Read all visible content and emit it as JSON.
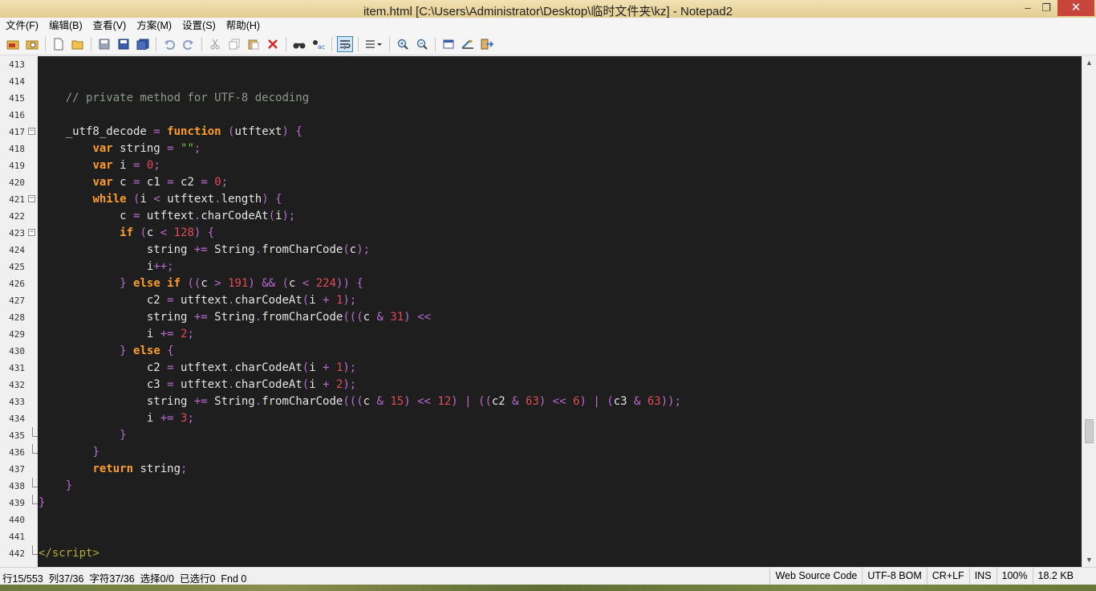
{
  "window": {
    "title": "item.html [C:\\Users\\Administrator\\Desktop\\临时文件夹\\kz] - Notepad2",
    "minimize_glyph": "–",
    "maximize_glyph": "❐",
    "close_glyph": "✕"
  },
  "menu": [
    "文件(F)",
    "编辑(B)",
    "查看(V)",
    "方案(M)",
    "设置(S)",
    "帮助(H)"
  ],
  "toolbar": {
    "icons": [
      "open-folder-icon",
      "browse-icon",
      "new-file-icon",
      "open-file-icon",
      "save-disabled-icon",
      "save-icon",
      "save-copy-icon",
      "undo-icon",
      "redo-icon",
      "cut-icon",
      "copy-icon",
      "paste-icon",
      "delete-icon",
      "find-icon",
      "replace-icon",
      "word-wrap-icon",
      "schemes-icon",
      "zoom-in-icon",
      "zoom-out-icon",
      "view-icon",
      "settings-icon",
      "exit-icon"
    ],
    "active_icon": "word-wrap-icon"
  },
  "editor": {
    "lines": [
      {
        "n": "413",
        "fold": "",
        "html": ""
      },
      {
        "n": "414",
        "fold": "",
        "html": ""
      },
      {
        "n": "415",
        "fold": "",
        "html": "    <span class='c'>// private method for UTF-8 decoding</span>"
      },
      {
        "n": "416",
        "fold": "",
        "html": ""
      },
      {
        "n": "417",
        "fold": "box",
        "html": "    _utf8_decode <span class='p'>=</span> <span class='k'>function</span> <span class='p'>(</span>utftext<span class='p'>)</span> <span class='p'>{</span>"
      },
      {
        "n": "418",
        "fold": "",
        "html": "        <span class='k'>var</span> string <span class='p'>=</span> <span class='s'>\"\"</span><span class='p'>;</span>"
      },
      {
        "n": "419",
        "fold": "",
        "html": "        <span class='k'>var</span> i <span class='p'>=</span> <span class='n'>0</span><span class='p'>;</span>"
      },
      {
        "n": "420",
        "fold": "",
        "html": "        <span class='k'>var</span> c <span class='p'>=</span> c1 <span class='p'>=</span> c2 <span class='p'>=</span> <span class='n'>0</span><span class='p'>;</span>"
      },
      {
        "n": "421",
        "fold": "box",
        "html": "        <span class='k'>while</span> <span class='p'>(</span>i <span class='p'>&lt;</span> utftext<span class='p'>.</span>length<span class='p'>)</span> <span class='p'>{</span>"
      },
      {
        "n": "422",
        "fold": "",
        "html": "            c <span class='p'>=</span> utftext<span class='p'>.</span>charCodeAt<span class='p'>(</span>i<span class='p'>);</span>"
      },
      {
        "n": "423",
        "fold": "box",
        "html": "            <span class='k'>if</span> <span class='p'>(</span>c <span class='p'>&lt;</span> <span class='n'>128</span><span class='p'>)</span> <span class='p'>{</span>"
      },
      {
        "n": "424",
        "fold": "",
        "html": "                string <span class='p'>+=</span> String<span class='p'>.</span>fromCharCode<span class='p'>(</span>c<span class='p'>);</span>"
      },
      {
        "n": "425",
        "fold": "",
        "html": "                i<span class='p'>++;</span>"
      },
      {
        "n": "426",
        "fold": "",
        "html": "            <span class='p'>}</span> <span class='k'>else if</span> <span class='p'>((</span>c <span class='p'>&gt;</span> <span class='n'>191</span><span class='p'>)</span> <span class='p'>&amp;&amp;</span> <span class='p'>(</span>c <span class='p'>&lt;</span> <span class='n'>224</span><span class='p'>))</span> <span class='p'>{</span>"
      },
      {
        "n": "427",
        "fold": "",
        "html": "                c2 <span class='p'>=</span> utftext<span class='p'>.</span>charCodeAt<span class='p'>(</span>i <span class='p'>+</span> <span class='n'>1</span><span class='p'>);</span>"
      },
      {
        "n": "428",
        "fold": "",
        "html": "                string <span class='p'>+=</span> String<span class='p'>.</span>fromCharCode<span class='p'>(((</span>c <span class='p'>&amp;</span> <span class='n'>31</span><span class='p'>)</span> <span class='p'>&lt;&lt;</span>"
      },
      {
        "n": "429",
        "fold": "",
        "html": "                i <span class='p'>+=</span> <span class='n'>2</span><span class='p'>;</span>"
      },
      {
        "n": "430",
        "fold": "",
        "html": "            <span class='p'>}</span> <span class='k'>else</span> <span class='p'>{</span>"
      },
      {
        "n": "431",
        "fold": "",
        "html": "                c2 <span class='p'>=</span> utftext<span class='p'>.</span>charCodeAt<span class='p'>(</span>i <span class='p'>+</span> <span class='n'>1</span><span class='p'>);</span>"
      },
      {
        "n": "432",
        "fold": "",
        "html": "                c3 <span class='p'>=</span> utftext<span class='p'>.</span>charCodeAt<span class='p'>(</span>i <span class='p'>+</span> <span class='n'>2</span><span class='p'>);</span>"
      },
      {
        "n": "433",
        "fold": "",
        "html": "                string <span class='p'>+=</span> String<span class='p'>.</span>fromCharCode<span class='p'>(((</span>c <span class='p'>&amp;</span> <span class='n'>15</span><span class='p'>)</span> <span class='p'>&lt;&lt;</span> <span class='n'>12</span><span class='p'>)</span> <span class='p'>|</span> <span class='p'>((</span>c2 <span class='p'>&amp;</span> <span class='n'>63</span><span class='p'>)</span> <span class='p'>&lt;&lt;</span> <span class='n'>6</span><span class='p'>)</span> <span class='p'>|</span> <span class='p'>(</span>c3 <span class='p'>&amp;</span> <span class='n'>63</span><span class='p'>));</span>"
      },
      {
        "n": "434",
        "fold": "",
        "html": "                i <span class='p'>+=</span> <span class='n'>3</span><span class='p'>;</span>"
      },
      {
        "n": "435",
        "fold": "end",
        "html": "            <span class='p'>}</span>"
      },
      {
        "n": "436",
        "fold": "end",
        "html": "        <span class='p'>}</span>"
      },
      {
        "n": "437",
        "fold": "",
        "html": "        <span class='k'>return</span> string<span class='p'>;</span>"
      },
      {
        "n": "438",
        "fold": "end",
        "html": "    <span class='p'>}</span>"
      },
      {
        "n": "439",
        "fold": "end",
        "html": "<span class='p'>}</span>"
      },
      {
        "n": "440",
        "fold": "",
        "html": ""
      },
      {
        "n": "441",
        "fold": "",
        "html": ""
      },
      {
        "n": "442",
        "fold": "end",
        "html": "<span class='t'>&lt;/script&gt;</span>"
      }
    ]
  },
  "scrollbar": {
    "position_fraction": 0.76,
    "up_glyph": "▲",
    "down_glyph": "▼"
  },
  "status": {
    "left": "行15/553  列37/36  字符37/36  选择0/0  已选行0  Fnd 0",
    "scheme": "Web Source Code",
    "encoding": "UTF-8 BOM",
    "line_endings": "CR+LF",
    "mode": "INS",
    "zoom": "100%",
    "size": "18.2 KB"
  },
  "colors": {
    "title_bar": "#e8d49a",
    "close_button": "#c7453a",
    "editor_bg": "#1e1e1e",
    "keyword": "#ff9d2b",
    "operator": "#b96ad2",
    "number": "#e04a56",
    "string": "#6fc23f",
    "comment": "#8a9a8e"
  }
}
